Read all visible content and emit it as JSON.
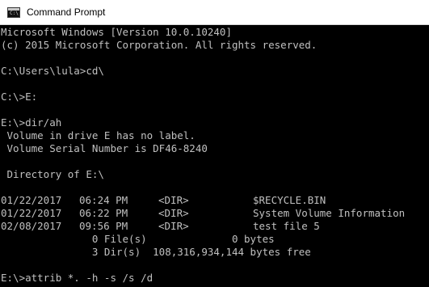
{
  "window": {
    "title": "Command Prompt",
    "icon": "console-window-icon",
    "icon_glyph": "C:\\"
  },
  "console": {
    "lines": [
      "Microsoft Windows [Version 10.0.10240]",
      "(c) 2015 Microsoft Corporation. All rights reserved.",
      "",
      "C:\\Users\\lula>cd\\",
      "",
      "C:\\>E:",
      "",
      "E:\\>dir/ah",
      " Volume in drive E has no label.",
      " Volume Serial Number is DF46-8240",
      "",
      " Directory of E:\\",
      ""
    ],
    "entries": [
      {
        "date": "01/22/2017",
        "time": "06:24 PM",
        "type": "<DIR>",
        "name": "$RECYCLE.BIN"
      },
      {
        "date": "01/22/2017",
        "time": "06:22 PM",
        "type": "<DIR>",
        "name": "System Volume Information"
      },
      {
        "date": "02/08/2017",
        "time": "09:56 PM",
        "type": "<DIR>",
        "name": "test file 5"
      }
    ],
    "summary": [
      "               0 File(s)              0 bytes",
      "               3 Dir(s)  108,316,934,144 bytes free"
    ],
    "trailing_lines": [
      "",
      "E:\\>attrib *. -h -s /s /d"
    ]
  },
  "colors": {
    "background": "#000000",
    "text": "#c0c0c0",
    "titlebar": "#ffffff"
  }
}
